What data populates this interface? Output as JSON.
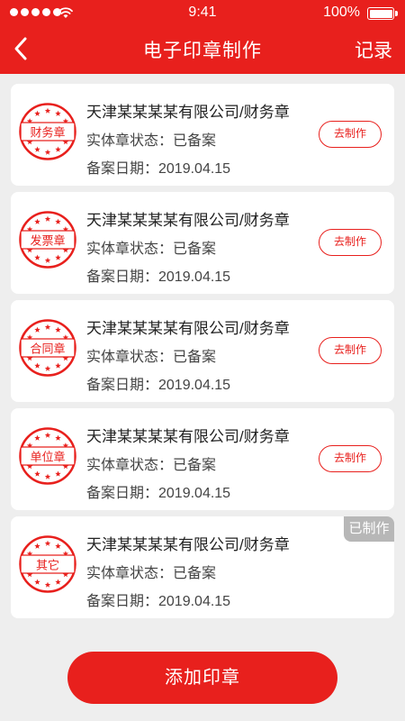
{
  "status_bar": {
    "time": "9:41",
    "battery": "100%"
  },
  "nav": {
    "title": "电子印章制作",
    "records": "记录"
  },
  "seals": [
    {
      "seal_text": "财务章",
      "company": "天津某某某某有限公司/财务章",
      "status": "实体章状态：已备案",
      "date": "备案日期：2019.04.15",
      "action": "去制作",
      "made": false
    },
    {
      "seal_text": "发票章",
      "company": "天津某某某某有限公司/财务章",
      "status": "实体章状态：已备案",
      "date": "备案日期：2019.04.15",
      "action": "去制作",
      "made": false
    },
    {
      "seal_text": "合同章",
      "company": "天津某某某某有限公司/财务章",
      "status": "实体章状态：已备案",
      "date": "备案日期：2019.04.15",
      "action": "去制作",
      "made": false
    },
    {
      "seal_text": "单位章",
      "company": "天津某某某某有限公司/财务章",
      "status": "实体章状态：已备案",
      "date": "备案日期：2019.04.15",
      "action": "去制作",
      "made": false
    },
    {
      "seal_text": "其它",
      "company": "天津某某某某有限公司/财务章",
      "status": "实体章状态：已备案",
      "date": "备案日期：2019.04.15",
      "badge": "已制作",
      "made": true
    }
  ],
  "add_button": "添加印章",
  "colors": {
    "accent": "#e8201d",
    "background": "#eeeeee",
    "badge": "#b7b7b7"
  }
}
